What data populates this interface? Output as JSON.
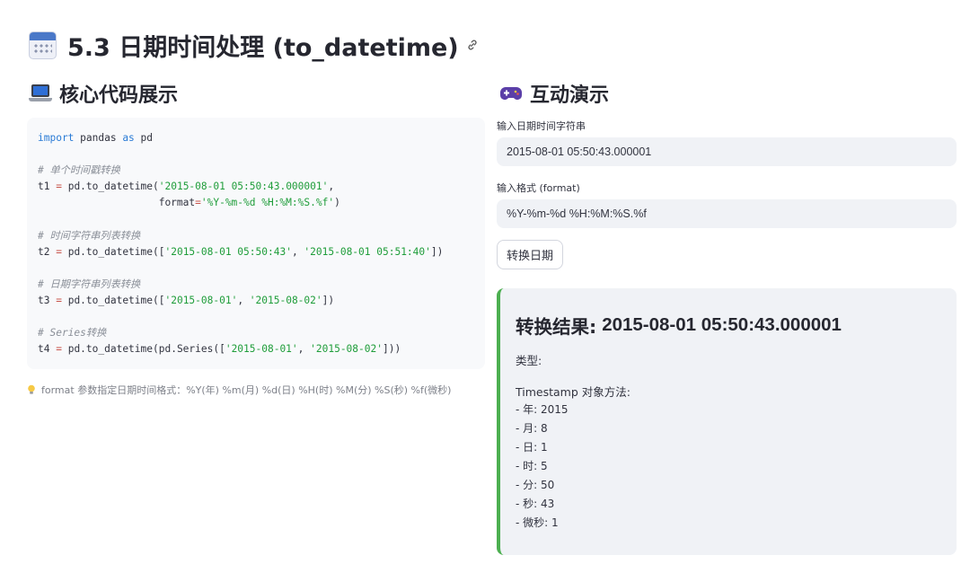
{
  "page": {
    "title": "5.3 日期时间处理 (to_datetime)",
    "title_icon": "calendar-icon",
    "link_icon": "link-icon"
  },
  "left": {
    "section_title": "核心代码展示",
    "section_icon": "laptop-icon",
    "code_lines": [
      [
        {
          "t": "import",
          "c": "kw"
        },
        {
          "t": " pandas "
        },
        {
          "t": "as",
          "c": "kw"
        },
        {
          "t": " pd"
        }
      ],
      [],
      [
        {
          "t": "# 单个时间戳转换",
          "c": "cm"
        }
      ],
      [
        {
          "t": "t1 "
        },
        {
          "t": "=",
          "c": "op"
        },
        {
          "t": " pd.to_datetime("
        },
        {
          "t": "'2015-08-01 05:50:43.000001'",
          "c": "st"
        },
        {
          "t": ","
        }
      ],
      [
        {
          "t": "                    format"
        },
        {
          "t": "=",
          "c": "op"
        },
        {
          "t": "'%Y-%m-%d %H:%M:%S.%f'",
          "c": "st"
        },
        {
          "t": ")"
        }
      ],
      [],
      [
        {
          "t": "# 时间字符串列表转换",
          "c": "cm"
        }
      ],
      [
        {
          "t": "t2 "
        },
        {
          "t": "=",
          "c": "op"
        },
        {
          "t": " pd.to_datetime(["
        },
        {
          "t": "'2015-08-01 05:50:43'",
          "c": "st"
        },
        {
          "t": ", "
        },
        {
          "t": "'2015-08-01 05:51:40'",
          "c": "st"
        },
        {
          "t": "])"
        }
      ],
      [],
      [
        {
          "t": "# 日期字符串列表转换",
          "c": "cm"
        }
      ],
      [
        {
          "t": "t3 "
        },
        {
          "t": "=",
          "c": "op"
        },
        {
          "t": " pd.to_datetime(["
        },
        {
          "t": "'2015-08-01'",
          "c": "st"
        },
        {
          "t": ", "
        },
        {
          "t": "'2015-08-02'",
          "c": "st"
        },
        {
          "t": "])"
        }
      ],
      [],
      [
        {
          "t": "# Series转换",
          "c": "cm"
        }
      ],
      [
        {
          "t": "t4 "
        },
        {
          "t": "=",
          "c": "op"
        },
        {
          "t": " pd.to_datetime(pd.Series(["
        },
        {
          "t": "'2015-08-01'",
          "c": "st"
        },
        {
          "t": ", "
        },
        {
          "t": "'2015-08-02'",
          "c": "st"
        },
        {
          "t": "]))"
        }
      ]
    ],
    "caption": "format 参数指定日期时间格式：%Y(年) %m(月) %d(日) %H(时) %M(分) %S(秒) %f(微秒)",
    "caption_icon": "lightbulb-icon"
  },
  "right": {
    "section_title": "互动演示",
    "section_icon": "gamepad-icon",
    "input1_label": "输入日期时间字符串",
    "input1_value": "2015-08-01 05:50:43.000001",
    "input2_label": "输入格式 (format)",
    "input2_value": "%Y-%m-%d %H:%M:%S.%f",
    "button_label": "转换日期",
    "result": {
      "title_prefix": "转换结果:",
      "title_value": "2015-08-01 05:50:43.000001",
      "type_label": "类型:",
      "methods_title": "Timestamp 对象方法:",
      "items": [
        "- 年: 2015",
        "- 月: 8",
        "- 日: 1",
        "- 时: 5",
        "- 分: 50",
        "- 秒: 43",
        "- 微秒: 1"
      ]
    }
  },
  "colors": {
    "accent_green": "#4caf50",
    "code_keyword": "#2a7bd5",
    "code_string": "#1f9d3a",
    "code_comment": "#8a8f98"
  }
}
